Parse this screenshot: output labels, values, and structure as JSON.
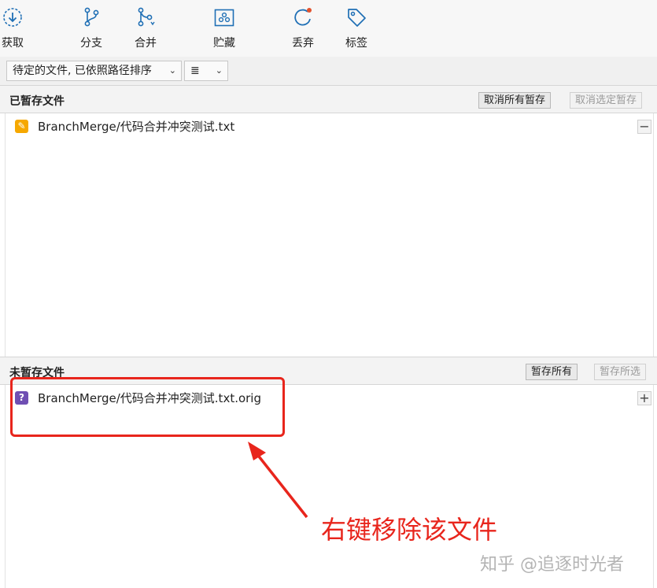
{
  "toolbar": {
    "items": [
      {
        "label": "获取",
        "icon": "fetch-icon"
      },
      {
        "label": "分支",
        "icon": "branch-icon"
      },
      {
        "label": "合并",
        "icon": "merge-icon"
      },
      {
        "label": "贮藏",
        "icon": "stash-icon"
      },
      {
        "label": "丢弃",
        "icon": "discard-icon"
      },
      {
        "label": "标签",
        "icon": "tag-icon"
      }
    ],
    "accent_color": "#1f6fb5"
  },
  "filter": {
    "sort_select": "待定的文件, 已依照路径排序",
    "view_select": "≣"
  },
  "staged": {
    "title": "已暂存文件",
    "unstage_all_label": "取消所有暂存",
    "unstage_selected_label": "取消选定暂存",
    "files": [
      {
        "name": "BranchMerge/代码合并冲突测试.txt",
        "status": "modified",
        "status_color": "#f6a800"
      }
    ]
  },
  "unstaged": {
    "title": "未暂存文件",
    "stage_all_label": "暂存所有",
    "stage_selected_label": "暂存所选",
    "files": [
      {
        "name": "BranchMerge/代码合并冲突测试.txt.orig",
        "status": "untracked",
        "status_color": "#6f4fb3"
      }
    ]
  },
  "annotation": {
    "text": "右键移除该文件",
    "color": "#e8251c"
  },
  "watermark": "知乎 @追逐时光者"
}
